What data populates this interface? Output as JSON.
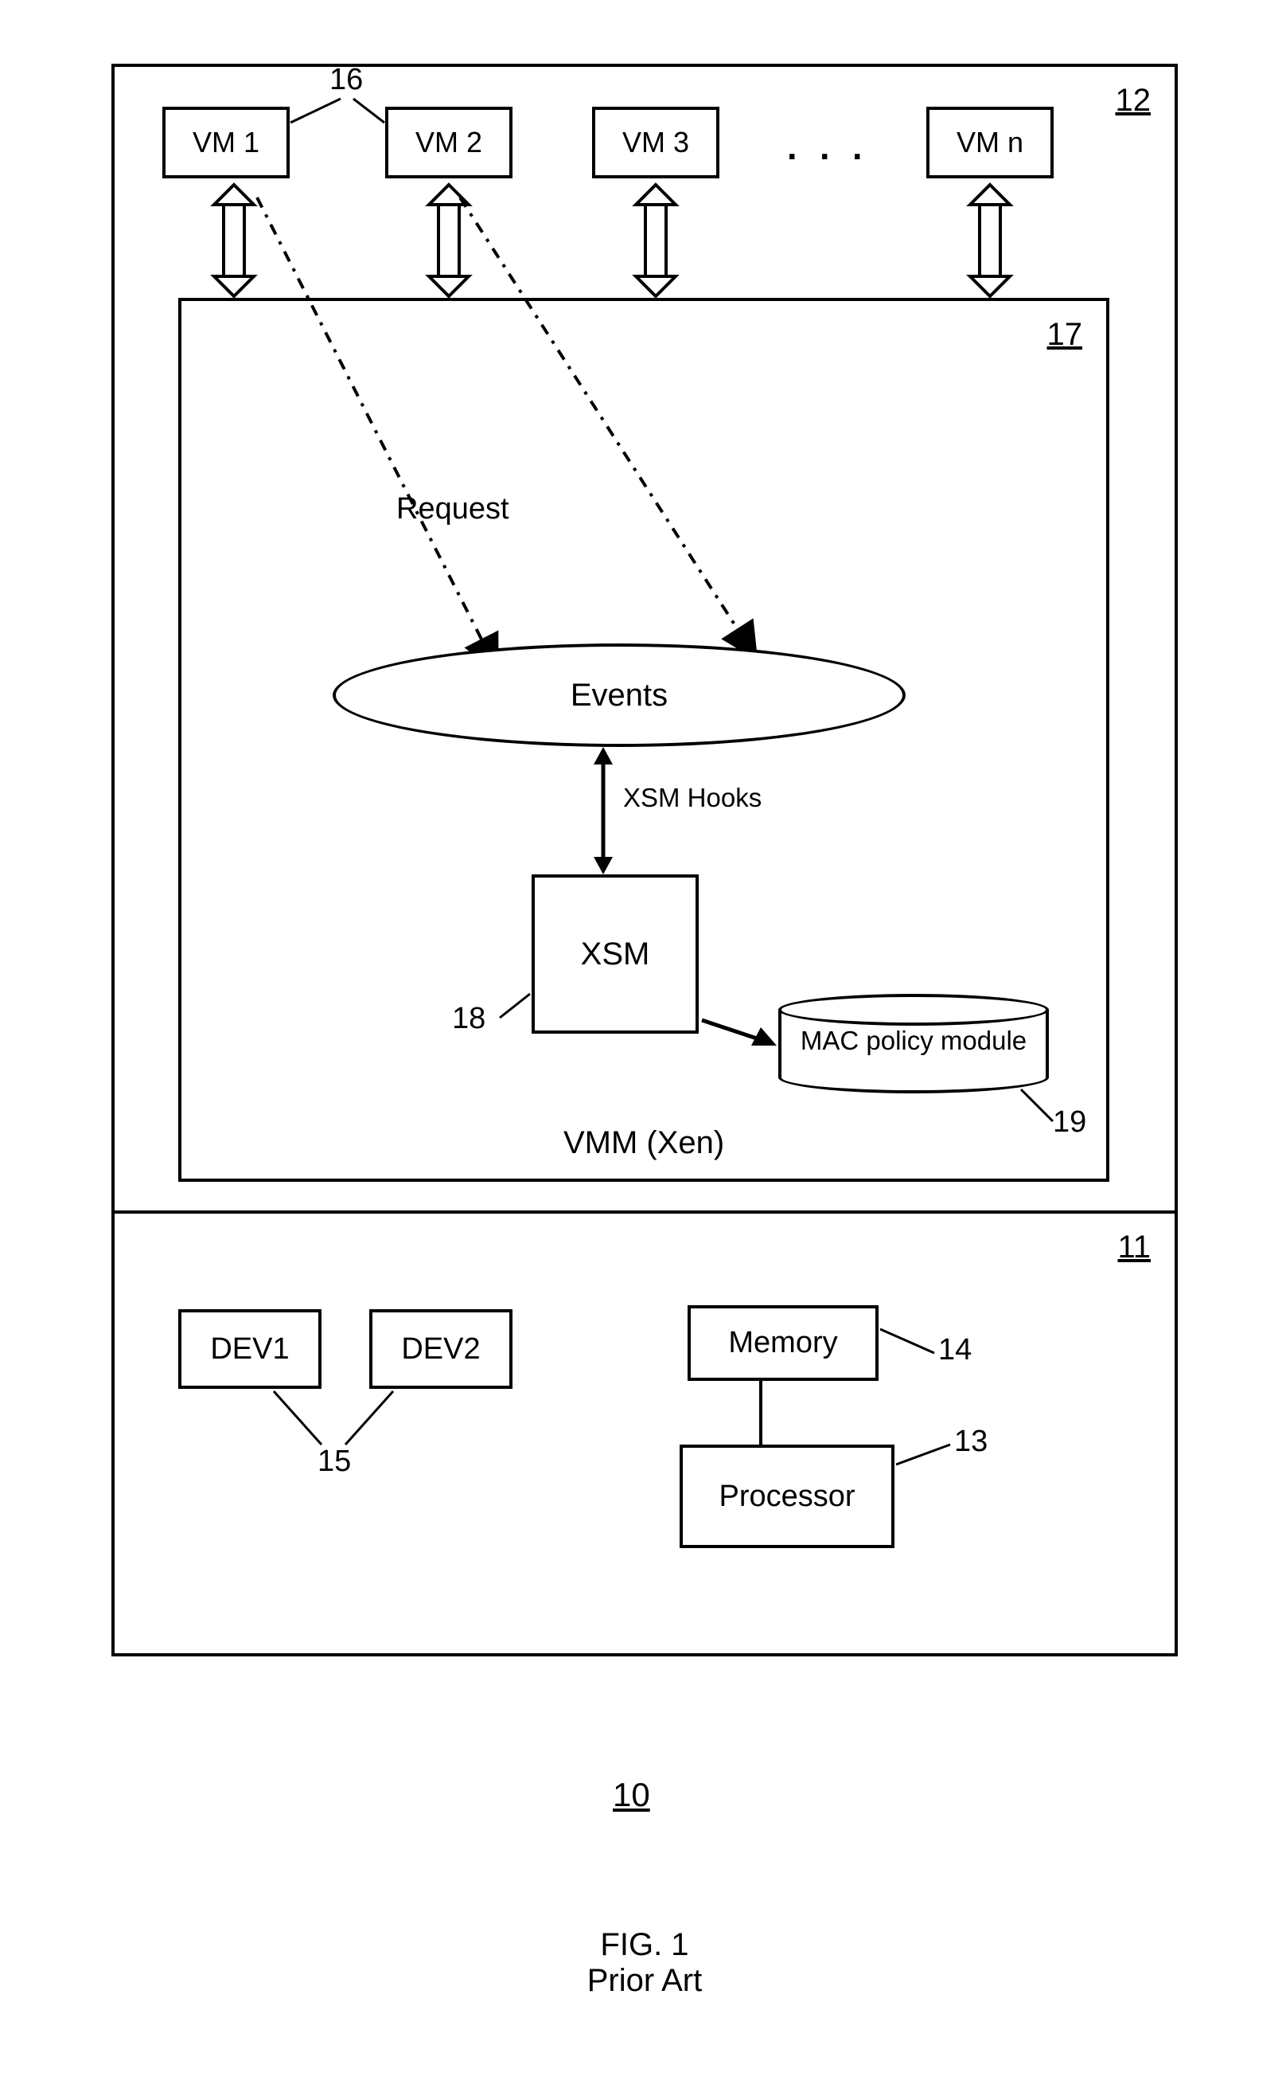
{
  "figure": {
    "number": "10",
    "label": "FIG. 1",
    "subtitle": "Prior Art"
  },
  "outer": {
    "upper_ref": "12",
    "lower_ref": "11"
  },
  "vms": {
    "vm1": "VM 1",
    "vm2": "VM 2",
    "vm3": "VM 3",
    "vmn": "VM n",
    "ref": "16",
    "ellipsis": ". . ."
  },
  "vmm": {
    "ref": "17",
    "caption": "VMM (Xen)",
    "request_label": "Request",
    "events_label": "Events",
    "xsm_hooks_label": "XSM Hooks",
    "xsm_label": "XSM",
    "xsm_ref": "18",
    "mac_label": "MAC policy module",
    "mac_ref": "19"
  },
  "hw": {
    "dev1": "DEV1",
    "dev2": "DEV2",
    "dev_ref": "15",
    "memory": "Memory",
    "memory_ref": "14",
    "processor": "Processor",
    "processor_ref": "13"
  }
}
